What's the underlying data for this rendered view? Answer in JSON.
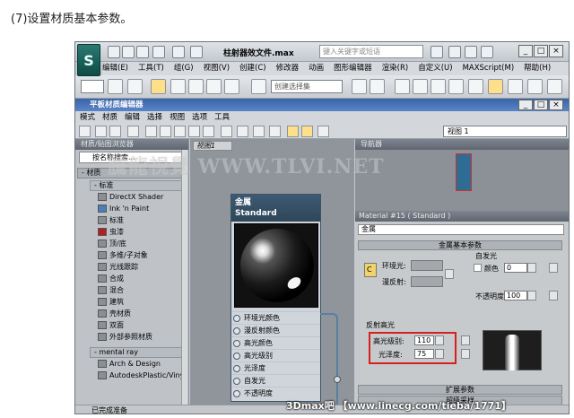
{
  "caption": "(7)设置材质基本参数。",
  "app": {
    "logo": "S",
    "doc_title": "柱射器效文件.max",
    "search_placeholder": "键入关键字或短语",
    "menu": [
      "编辑(E)",
      "工具(T)",
      "组(G)",
      "视图(V)",
      "创建(C)",
      "修改器",
      "动画",
      "图形编辑器",
      "渲染(R)",
      "自定义(U)",
      "MAXScript(M)",
      "帮助(H)"
    ],
    "selection_set_placeholder": "创建选择集"
  },
  "slate": {
    "title": "平板材质编辑器",
    "menu": [
      "模式",
      "材质",
      "编辑",
      "选择",
      "视图",
      "选项",
      "工具"
    ],
    "view_select": "视图 1"
  },
  "browser": {
    "header": "材质/贴图浏览器",
    "search": "按名称搜索...",
    "group_materials": "- 材质",
    "sub_standard": "- 标准",
    "standard_items": [
      "DirectX Shader",
      "Ink 'n Paint",
      "标准",
      "虫漆",
      "顶/底",
      "多维/子对象",
      "光线跟踪",
      "合成",
      "混合",
      "建筑",
      "壳材质",
      "双面",
      "外部参照材质"
    ],
    "sub_mental_ray": "- mental ray",
    "mental_ray_items": [
      "Arch & Design",
      "AutodeskPlastic/Vinyl"
    ]
  },
  "view": {
    "tab": "视图1",
    "node_title": "金属",
    "node_type": "Standard",
    "slots": [
      "环境光颜色",
      "漫反射颜色",
      "高光颜色",
      "高光级别",
      "光泽度",
      "自发光",
      "不透明度"
    ]
  },
  "navigator": {
    "header": "导航器"
  },
  "params": {
    "header": "Material #15 ( Standard )",
    "material_name": "金属",
    "rollout_basic": "金属基本参数",
    "ambient_label": "环境光:",
    "diffuse_label": "漫反射:",
    "lock_glyph": "C",
    "self_illum_group": "自发光",
    "color_label": "颜色",
    "self_illum_value": "0",
    "opacity_label": "不透明度:",
    "opacity_value": "100",
    "specular_group": "反射高光",
    "spec_level_label": "高光级别:",
    "spec_level_value": "110",
    "glossiness_label": "光泽度:",
    "glossiness_value": "75",
    "rollout_extended": "扩展参数",
    "rollout_supersampling": "超级采样"
  },
  "status": {
    "text": "已完成准备"
  },
  "watermark": "騰龍視覺 WWW.TLVI.NET",
  "footer_watermark": "3Dmax吧 【www.linecg.com/tieba/1771】",
  "colors": {
    "title_blue": "#3a63a8",
    "node_head": "#2e4659",
    "highlight_red": "#d61f1f"
  }
}
